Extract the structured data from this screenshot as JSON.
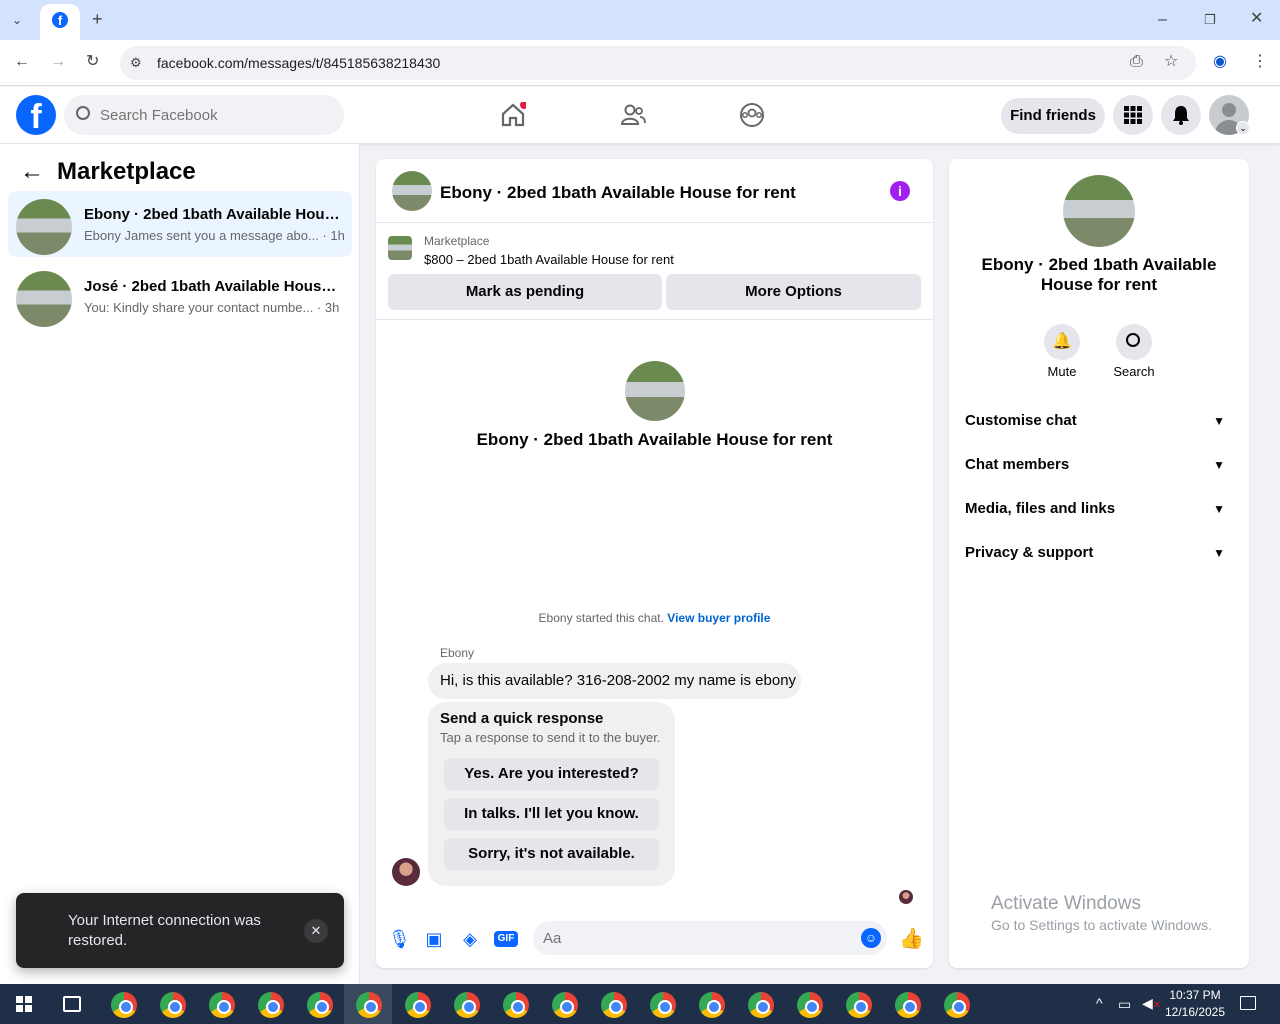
{
  "browser": {
    "url": "facebook.com/messages/t/845185638218430",
    "tab_icon": "facebook-icon"
  },
  "header": {
    "search_placeholder": "Search Facebook",
    "find_friends": "Find friends"
  },
  "left": {
    "title": "Marketplace",
    "conversations": [
      {
        "title": "Ebony · 2bed 1bath Available House for rent",
        "preview": "Ebony James sent you a message abo... · 1h"
      },
      {
        "title": "José · 2bed 1bath Available House for rent",
        "preview": "You: Kindly share your contact numbe... · 3h"
      }
    ]
  },
  "chat": {
    "title": "Ebony · 2bed 1bath Available House for rent",
    "listing_source": "Marketplace",
    "listing_line": "$800 – 2bed 1bath Available House for rent",
    "mark_pending": "Mark as pending",
    "more_options": "More Options",
    "intro_title": "Ebony · 2bed 1bath Available House for rent",
    "started_text": "Ebony started this chat.",
    "buyer_profile_link": "View buyer profile",
    "sender_name": "Ebony",
    "message": "Hi, is this available? 316-208-2002 my name is ebony",
    "quick_title": "Send a quick response",
    "quick_subtitle": "Tap a response to send it to the buyer.",
    "quick_responses": [
      "Yes. Are you interested?",
      "In talks. I'll let you know.",
      "Sorry, it's not available."
    ],
    "composer_placeholder": "Aa"
  },
  "info": {
    "title": "Ebony · 2bed 1bath Available House for rent",
    "mute": "Mute",
    "search": "Search",
    "sections": [
      "Customise chat",
      "Chat members",
      "Media, files and links",
      "Privacy & support"
    ]
  },
  "toast": {
    "text": "Your Internet connection was restored."
  },
  "watermark": {
    "line1": "Activate Windows",
    "line2": "Go to Settings to activate Windows."
  },
  "taskbar": {
    "time": "10:37 PM",
    "date": "12/16/2025"
  }
}
